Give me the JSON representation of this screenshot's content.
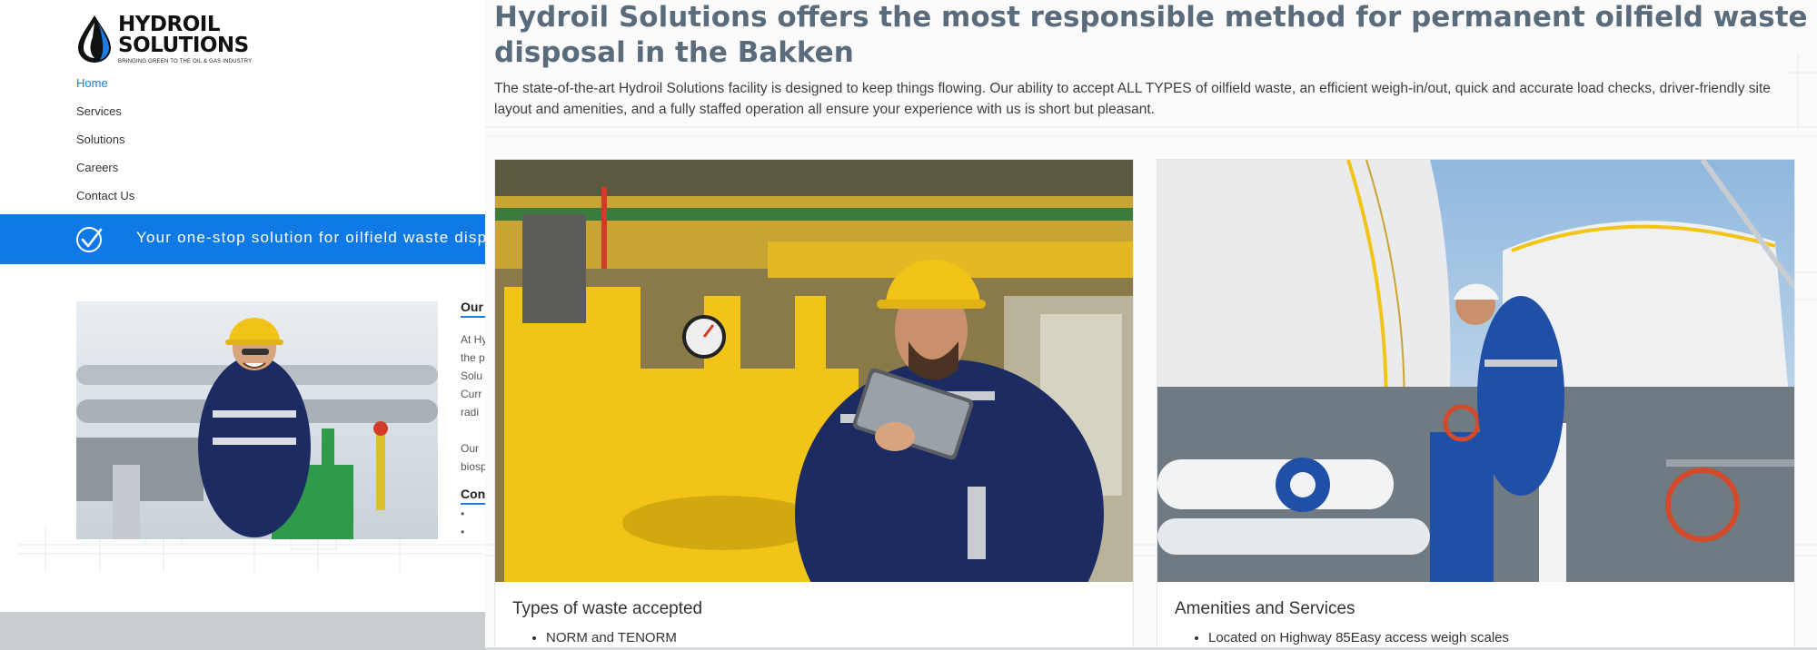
{
  "logo": {
    "line1": "HYDROIL",
    "line2": "SOLUTIONS",
    "tagline": "BRINGING GREEN TO THE OIL & GAS INDUSTRY"
  },
  "nav": {
    "items": [
      {
        "label": "Home",
        "active": true
      },
      {
        "label": "Services",
        "active": false
      },
      {
        "label": "Solutions",
        "active": false
      },
      {
        "label": "Careers",
        "active": false
      },
      {
        "label": "Contact Us",
        "active": false
      }
    ]
  },
  "banner": {
    "text": "Your one-stop solution for oilfield waste disposal",
    "icon": "check-circle-icon"
  },
  "side_column": {
    "heading1": "Our",
    "lines1": [
      "At Hy",
      "the p",
      "Solu",
      "Curr",
      "radi"
    ],
    "lines2": [
      "Our",
      "biosp"
    ],
    "heading2": "Con"
  },
  "main": {
    "headline": "Hydroil Solutions offers the most responsible method for permanent oilfield waste disposal in the Bakken",
    "intro": "The state-of-the-art Hydroil Solutions facility is designed to keep things flowing. Our ability to accept ALL TYPES of oilfield waste, an efficient weigh-in/out, quick and accurate load checks, driver-friendly site layout and amenities, and a fully staffed operation all ensure your experience with us is short but pleasant.",
    "cards": [
      {
        "title": "Types of waste accepted",
        "items": [
          "NORM and TENORM"
        ]
      },
      {
        "title": "Amenities and Services",
        "items": [
          "Located on Highway 85Easy access weigh scales"
        ]
      }
    ]
  },
  "colors": {
    "accent_blue": "#0f7ae5",
    "headline_gray": "#5a6b7b",
    "hardhat_yellow": "#f2c418",
    "uniform_navy": "#1d2b63"
  }
}
